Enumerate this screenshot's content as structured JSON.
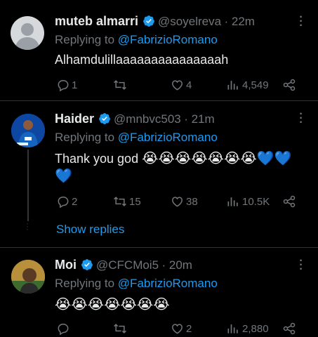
{
  "tweets": [
    {
      "name": "muteb almarri",
      "handle": "@soyelreva",
      "time": "· 22m",
      "replying_prefix": "Replying to",
      "replying_to": "@FabrizioRomano",
      "text": "Alhamdulillaaaaaaaaaaaaaaah",
      "emojis": "",
      "stats": {
        "replies": "1",
        "retweets": "",
        "likes": "4",
        "views": "4,549"
      }
    },
    {
      "name": "Haider",
      "handle": "@mnbvc503",
      "time": "· 21m",
      "replying_prefix": "Replying to",
      "replying_to": "@FabrizioRomano",
      "text": "Thank you god",
      "emojis": "😭😭😭😭😭😭😭💙💙",
      "emojis_line2": "💙",
      "stats": {
        "replies": "2",
        "retweets": "15",
        "likes": "38",
        "views": "10.5K"
      },
      "show_replies": "Show replies"
    },
    {
      "name": "Moi",
      "handle": "@CFCMoi5",
      "time": "· 20m",
      "replying_prefix": "Replying to",
      "replying_to": "@FabrizioRomano",
      "text": "",
      "emojis": "😭😭😭😭😭😭😭",
      "stats": {
        "replies": "",
        "retweets": "",
        "likes": "2",
        "views": "2,880"
      }
    }
  ],
  "colors": {
    "accent": "#1d9bf0",
    "muted": "#71767b",
    "text": "#e7e9ea",
    "divider": "#2f3336"
  },
  "icons": [
    "reply-icon",
    "retweet-icon",
    "like-icon",
    "views-icon",
    "share-icon",
    "verified-badge-icon",
    "more-icon"
  ]
}
